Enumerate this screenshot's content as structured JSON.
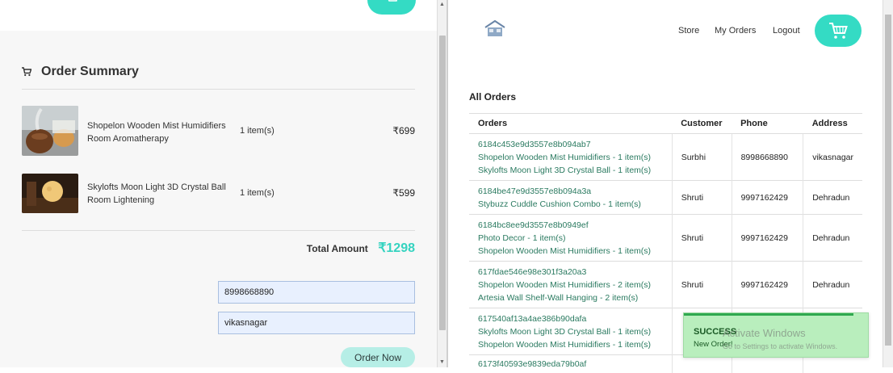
{
  "left": {
    "topbar_partial_text": "",
    "summary_title": "Order Summary",
    "items": [
      {
        "name": "Shopelon Wooden Mist Humidifiers Room Aromatherapy",
        "qty": "1 item(s)",
        "price": "₹699"
      },
      {
        "name": "Skylofts Moon Light 3D Crystal Ball Room Lightening",
        "qty": "1 item(s)",
        "price": "₹599"
      }
    ],
    "total_label": "Total Amount",
    "total_value": "₹1298",
    "phone_value": "8998668890",
    "address_value": "vikasnagar",
    "order_button": "Order Now"
  },
  "right": {
    "logo_text": "",
    "nav": {
      "store": "Store",
      "my_orders": "My Orders",
      "logout": "Logout"
    },
    "all_orders_title": "All Orders",
    "columns": [
      "Orders",
      "Customer",
      "Phone",
      "Address"
    ],
    "orders": [
      {
        "id": "6184c453e9d3557e8b094ab7",
        "lines": [
          "Shopelon Wooden Mist Humidifiers - 1 item(s)",
          "Skylofts Moon Light 3D Crystal Ball - 1 item(s)"
        ],
        "customer": "Surbhi",
        "phone": "8998668890",
        "address": "vikasnagar"
      },
      {
        "id": "6184be47e9d3557e8b094a3a",
        "lines": [
          "Stybuzz Cuddle Cushion Combo - 1 item(s)"
        ],
        "customer": "Shruti",
        "phone": "9997162429",
        "address": "Dehradun"
      },
      {
        "id": "6184bc8ee9d3557e8b0949ef",
        "lines": [
          "Photo Decor - 1 item(s)",
          "Shopelon Wooden Mist Humidifiers - 1 item(s)"
        ],
        "customer": "Shruti",
        "phone": "9997162429",
        "address": "Dehradun"
      },
      {
        "id": "617fdae546e98e301f3a20a3",
        "lines": [
          "Shopelon Wooden Mist Humidifiers - 2 item(s)",
          "Artesia Wall Shelf-Wall Hanging - 2 item(s)"
        ],
        "customer": "Shruti",
        "phone": "9997162429",
        "address": "Dehradun"
      },
      {
        "id": "617540af13a4ae386b90dafa",
        "lines": [
          "Skylofts Moon Light 3D Crystal Ball - 1 item(s)",
          "Shopelon Wooden Mist Humidifiers - 1 item(s)"
        ],
        "customer": "",
        "phone": "",
        "address": ""
      },
      {
        "id": "6173f40593e9839eda79b0af",
        "lines": [],
        "customer": "",
        "phone": "",
        "address": ""
      }
    ]
  },
  "toast": {
    "title": "SUCCESS",
    "message": "New Order!"
  },
  "watermark": {
    "title": "Activate Windows",
    "subtitle": "Go to Settings to activate Windows."
  },
  "colors": {
    "accent": "#34dbc4",
    "total": "#35d3c0",
    "link": "#2a7a60",
    "toast_bg": "#b9eebd"
  }
}
